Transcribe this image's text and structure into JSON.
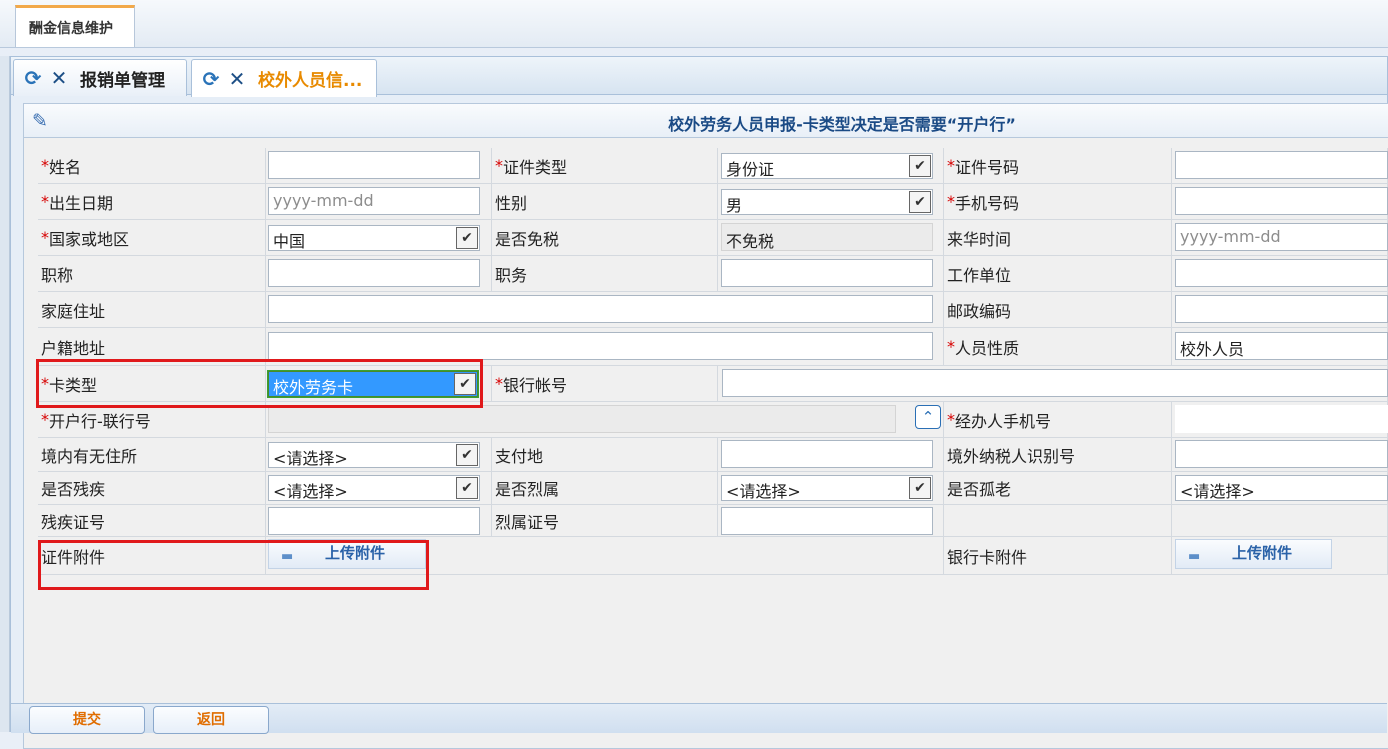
{
  "top_tab": {
    "label": "酬金信息维护"
  },
  "sub_tabs": [
    {
      "label": "报销单管理"
    },
    {
      "label": "校外人员信..."
    }
  ],
  "form": {
    "title": "校外劳务人员申报-卡类型决定是否需要“开户行”",
    "required_mark": "*",
    "fields": {
      "name": {
        "label": "姓名",
        "value": ""
      },
      "id_type": {
        "label": "证件类型",
        "value": "身份证"
      },
      "id_number": {
        "label": "证件号码",
        "value": ""
      },
      "birth_date": {
        "label": "出生日期",
        "placeholder": "yyyy-mm-dd"
      },
      "gender": {
        "label": "性别",
        "value": "男"
      },
      "mobile": {
        "label": "手机号码",
        "value": ""
      },
      "country": {
        "label": "国家或地区",
        "value": "中国"
      },
      "tax_exempt": {
        "label": "是否免税",
        "value": "不免税"
      },
      "arrival_time": {
        "label": "来华时间",
        "placeholder": "yyyy-mm-dd"
      },
      "title_rank": {
        "label": "职称",
        "value": ""
      },
      "position": {
        "label": "职务",
        "value": ""
      },
      "employer": {
        "label": "工作单位",
        "value": ""
      },
      "home_address": {
        "label": "家庭住址",
        "value": ""
      },
      "postcode": {
        "label": "邮政编码",
        "value": ""
      },
      "hukou_address": {
        "label": "户籍地址",
        "value": ""
      },
      "person_type": {
        "label": "人员性质",
        "value": "校外人员"
      },
      "card_type": {
        "label": "卡类型",
        "value": "校外劳务卡"
      },
      "bank_account": {
        "label": "银行帐号",
        "value": ""
      },
      "bank_branch": {
        "label": "开户行-联行号",
        "value": ""
      },
      "handler_mobile": {
        "label": "经办人手机号",
        "value": ""
      },
      "domestic_residence": {
        "label": "境内有无住所",
        "value": "<请选择>"
      },
      "pay_place": {
        "label": "支付地",
        "value": ""
      },
      "foreign_tax_id": {
        "label": "境外纳税人识别号",
        "value": ""
      },
      "disabled": {
        "label": "是否残疾",
        "value": "<请选择>"
      },
      "martyr": {
        "label": "是否烈属",
        "value": "<请选择>"
      },
      "orphan_elder": {
        "label": "是否孤老",
        "value": "<请选择>"
      },
      "disability_cert": {
        "label": "残疾证号",
        "value": ""
      },
      "martyr_cert": {
        "label": "烈属证号",
        "value": ""
      },
      "id_attachment": {
        "label": "证件附件",
        "button": "上传附件"
      },
      "bank_card_attachment": {
        "label": "银行卡附件",
        "button": "上传附件"
      }
    }
  },
  "footer": {
    "submit": "提交",
    "back": "返回"
  },
  "colors": {
    "accent_orange": "#e88a00",
    "highlight_red": "#e0191b",
    "select_blue": "#3399ff"
  }
}
